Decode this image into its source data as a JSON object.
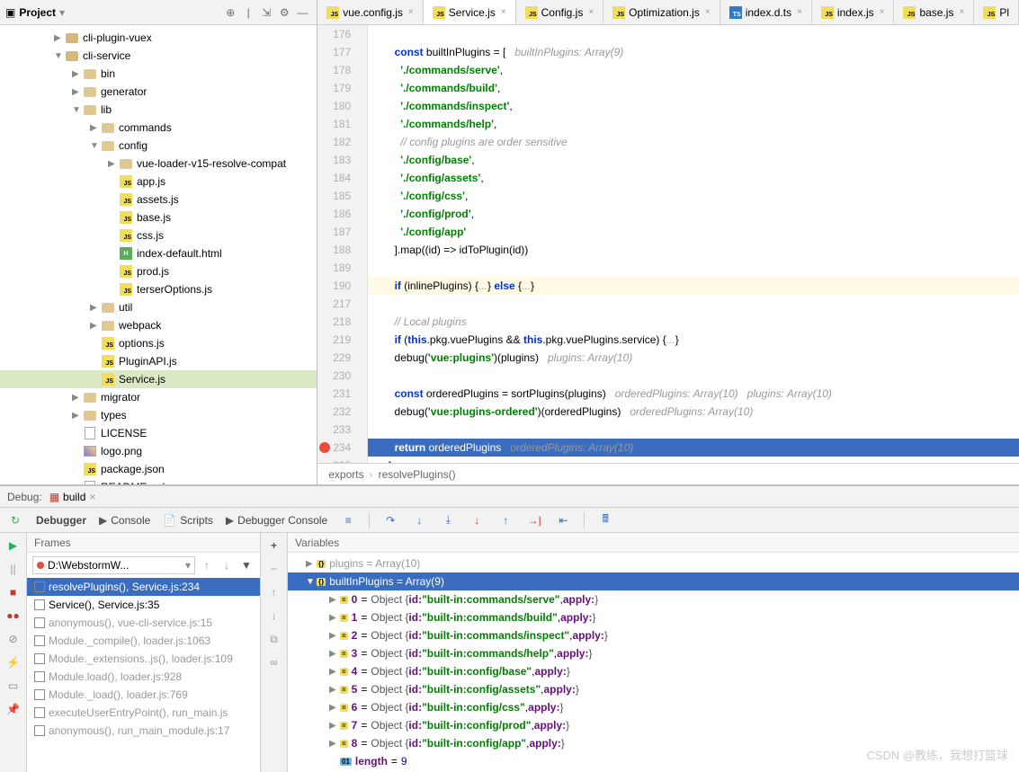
{
  "project": {
    "title": "Project",
    "tree": [
      {
        "indent": 60,
        "arrow": "▶",
        "icon": "folder",
        "label": "cli-plugin-vuex"
      },
      {
        "indent": 60,
        "arrow": "▼",
        "icon": "folder",
        "label": "cli-service"
      },
      {
        "indent": 80,
        "arrow": "▶",
        "icon": "folder-exp",
        "label": "bin"
      },
      {
        "indent": 80,
        "arrow": "▶",
        "icon": "folder-exp",
        "label": "generator"
      },
      {
        "indent": 80,
        "arrow": "▼",
        "icon": "folder-exp",
        "label": "lib"
      },
      {
        "indent": 100,
        "arrow": "▶",
        "icon": "folder-exp",
        "label": "commands"
      },
      {
        "indent": 100,
        "arrow": "▼",
        "icon": "folder-exp",
        "label": "config"
      },
      {
        "indent": 120,
        "arrow": "▶",
        "icon": "folder-exp",
        "label": "vue-loader-v15-resolve-compat"
      },
      {
        "indent": 120,
        "arrow": "",
        "icon": "js",
        "label": "app.js"
      },
      {
        "indent": 120,
        "arrow": "",
        "icon": "js",
        "label": "assets.js"
      },
      {
        "indent": 120,
        "arrow": "",
        "icon": "js",
        "label": "base.js"
      },
      {
        "indent": 120,
        "arrow": "",
        "icon": "js",
        "label": "css.js"
      },
      {
        "indent": 120,
        "arrow": "",
        "icon": "html",
        "label": "index-default.html"
      },
      {
        "indent": 120,
        "arrow": "",
        "icon": "js",
        "label": "prod.js"
      },
      {
        "indent": 120,
        "arrow": "",
        "icon": "js",
        "label": "terserOptions.js"
      },
      {
        "indent": 100,
        "arrow": "▶",
        "icon": "folder-exp",
        "label": "util"
      },
      {
        "indent": 100,
        "arrow": "▶",
        "icon": "folder-exp",
        "label": "webpack"
      },
      {
        "indent": 100,
        "arrow": "",
        "icon": "js",
        "label": "options.js"
      },
      {
        "indent": 100,
        "arrow": "",
        "icon": "js",
        "label": "PluginAPI.js"
      },
      {
        "indent": 100,
        "arrow": "",
        "icon": "js",
        "label": "Service.js",
        "selected": true
      },
      {
        "indent": 80,
        "arrow": "▶",
        "icon": "folder-exp",
        "label": "migrator"
      },
      {
        "indent": 80,
        "arrow": "▶",
        "icon": "folder-exp",
        "label": "types"
      },
      {
        "indent": 80,
        "arrow": "",
        "icon": "file",
        "label": "LICENSE"
      },
      {
        "indent": 80,
        "arrow": "",
        "icon": "img",
        "label": "logo.png"
      },
      {
        "indent": 80,
        "arrow": "",
        "icon": "js",
        "label": "package.json"
      },
      {
        "indent": 80,
        "arrow": "",
        "icon": "file",
        "label": "README.md"
      }
    ]
  },
  "tabs": [
    {
      "icon": "js",
      "label": "vue.config.js",
      "close": true
    },
    {
      "icon": "js",
      "label": "Service.js",
      "close": true,
      "active": true
    },
    {
      "icon": "js",
      "label": "Config.js",
      "close": true
    },
    {
      "icon": "js",
      "label": "Optimization.js",
      "close": true
    },
    {
      "icon": "ts",
      "label": "index.d.ts",
      "close": true
    },
    {
      "icon": "js",
      "label": "index.js",
      "close": true
    },
    {
      "icon": "js",
      "label": "base.js",
      "close": true
    },
    {
      "icon": "js",
      "label": "Pl"
    }
  ],
  "code": {
    "lines": [
      {
        "n": 176,
        "html": ""
      },
      {
        "n": 177,
        "html": "    <span class='kw-blue'>const</span> builtInPlugins = [   <span class='hint'>builtInPlugins: Array(9)</span>"
      },
      {
        "n": 178,
        "html": "      <span class='str'>'./commands/serve'</span>,"
      },
      {
        "n": 179,
        "html": "      <span class='str'>'./commands/build'</span>,"
      },
      {
        "n": 180,
        "html": "      <span class='str'>'./commands/inspect'</span>,"
      },
      {
        "n": 181,
        "html": "      <span class='str'>'./commands/help'</span>,"
      },
      {
        "n": 182,
        "html": "      <span class='cmt'>// config plugins are order sensitive</span>"
      },
      {
        "n": 183,
        "html": "      <span class='str'>'./config/base'</span>,"
      },
      {
        "n": 184,
        "html": "      <span class='str'>'./config/assets'</span>,"
      },
      {
        "n": 185,
        "html": "      <span class='str'>'./config/css'</span>,"
      },
      {
        "n": 186,
        "html": "      <span class='str'>'./config/prod'</span>,"
      },
      {
        "n": 187,
        "html": "      <span class='str'>'./config/app'</span>"
      },
      {
        "n": 188,
        "html": "    ].map((id) =&gt; idToPlugin(id))"
      },
      {
        "n": 189,
        "html": ""
      },
      {
        "n": 190,
        "cls": "hl-light",
        "html": "    <span class='kw-blue'>if</span> (inlinePlugins) {<span class='hint'>...</span>} <span class='kw-blue'>else</span> {<span class='hint'>...</span>}"
      },
      {
        "n": 217,
        "html": ""
      },
      {
        "n": 218,
        "html": "    <span class='cmt'>// Local plugins</span>"
      },
      {
        "n": 219,
        "html": "    <span class='kw-blue'>if</span> (<span class='kw-blue'>this</span>.pkg.vuePlugins && <span class='kw-blue'>this</span>.pkg.vuePlugins.service) {<span class='hint'>...</span>}"
      },
      {
        "n": 229,
        "html": "    debug(<span class='str'>'vue:plugins'</span>)(plugins)   <span class='hint'>plugins: Array(10)</span>"
      },
      {
        "n": 230,
        "html": ""
      },
      {
        "n": 231,
        "html": "    <span class='kw-blue'>const</span> orderedPlugins = sortPlugins(plugins)   <span class='hint'>orderedPlugins: Array(10)   plugins: Array(10)</span>"
      },
      {
        "n": 232,
        "html": "    debug(<span class='str'>'vue:plugins-ordered'</span>)(orderedPlugins)   <span class='hint'>orderedPlugins: Array(10)</span>"
      },
      {
        "n": 233,
        "html": ""
      },
      {
        "n": 234,
        "cls": "hl-exec",
        "bp": true,
        "html": "    <span class='kw-blue' style='color:#fff;'>return</span> orderedPlugins   <span class='hint'>orderedPlugins: Array(10)</span>"
      },
      {
        "n": 235,
        "html": "  }"
      }
    ]
  },
  "breadcrumb": {
    "a": "exports",
    "b": "resolvePlugins()"
  },
  "debug": {
    "label": "Debug:",
    "config": "build",
    "tabs": [
      "Debugger",
      "Console",
      "Scripts",
      "Debugger Console"
    ],
    "frames_title": "Frames",
    "vars_title": "Variables",
    "thread": "D:\\WebstormW...",
    "frames": [
      {
        "label": "resolvePlugins(), Service.js:234",
        "active": true
      },
      {
        "label": "Service(), Service.js:35"
      },
      {
        "label": "anonymous(), vue-cli-service.js:15",
        "dim": true
      },
      {
        "label": "Module._compile(), loader.js:1063",
        "dim": true
      },
      {
        "label": "Module._extensions..js(), loader.js:109",
        "dim": true
      },
      {
        "label": "Module.load(), loader.js:928",
        "dim": true
      },
      {
        "label": "Module._load(), loader.js:769",
        "dim": true
      },
      {
        "label": "executeUserEntryPoint(), run_main.js",
        "dim": true
      },
      {
        "label": "anonymous(), run_main_module.js:17",
        "dim": true
      }
    ],
    "varsHeader": "builtInPlugins = Array(9)",
    "vars": [
      {
        "idx": "0",
        "id": "built-in:commands/serve"
      },
      {
        "idx": "1",
        "id": "built-in:commands/build"
      },
      {
        "idx": "2",
        "id": "built-in:commands/inspect"
      },
      {
        "idx": "3",
        "id": "built-in:commands/help"
      },
      {
        "idx": "4",
        "id": "built-in:config/base"
      },
      {
        "idx": "5",
        "id": "built-in:config/assets"
      },
      {
        "idx": "6",
        "id": "built-in:config/css"
      },
      {
        "idx": "7",
        "id": "built-in:config/prod"
      },
      {
        "idx": "8",
        "id": "built-in:config/app"
      }
    ],
    "length_label": "length",
    "length_value": "9",
    "plugins_header": "plugins = Array(10)"
  },
  "watermark": "CSDN @教练，我想打篮球"
}
